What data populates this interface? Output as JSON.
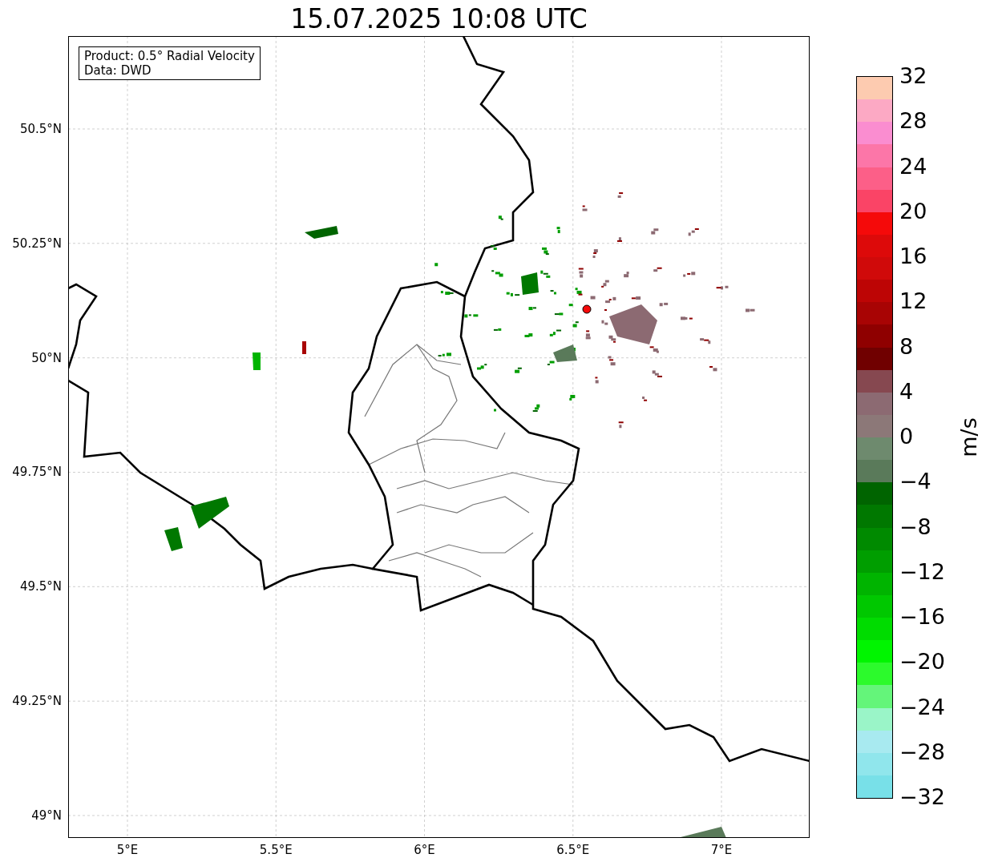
{
  "title": "15.07.2025 10:08 UTC",
  "info_box": {
    "lines": [
      "Product: 0.5° Radial Velocity",
      "Data: DWD"
    ]
  },
  "y_axis": {
    "ticks": [
      "50.5°N",
      "50.25°N",
      "50°N",
      "49.75°N",
      "49.5°N",
      "49.25°N",
      "49°N"
    ]
  },
  "x_axis": {
    "ticks": [
      "5°E",
      "5.5°E",
      "6°E",
      "6.5°E",
      "7°E"
    ]
  },
  "colorbar": {
    "label": "m/s",
    "ticks": [
      "32",
      "28",
      "24",
      "20",
      "16",
      "12",
      "8",
      "4",
      "0",
      "−4",
      "−8",
      "−12",
      "−16",
      "−20",
      "−24",
      "−28",
      "−32"
    ],
    "bins": [
      {
        "color": "#fdcbb0"
      },
      {
        "color": "#fca9c4"
      },
      {
        "color": "#fa8dd0"
      },
      {
        "color": "#fc76a8"
      },
      {
        "color": "#fc5f88"
      },
      {
        "color": "#fa4466"
      },
      {
        "color": "#f50a0a"
      },
      {
        "color": "#dd0a0a"
      },
      {
        "color": "#d00a0a"
      },
      {
        "color": "#bd0505"
      },
      {
        "color": "#a80404"
      },
      {
        "color": "#8f0000"
      },
      {
        "color": "#700000"
      },
      {
        "color": "#864850"
      },
      {
        "color": "#8c6a72"
      },
      {
        "color": "#8c7878"
      },
      {
        "color": "#6e8a6e"
      },
      {
        "color": "#5a7a5a"
      },
      {
        "color": "#006400"
      },
      {
        "color": "#007800"
      },
      {
        "color": "#008a00"
      },
      {
        "color": "#009e00"
      },
      {
        "color": "#00b400"
      },
      {
        "color": "#00c800"
      },
      {
        "color": "#00dc00"
      },
      {
        "color": "#00f500"
      },
      {
        "color": "#2cfa2c"
      },
      {
        "color": "#64f57a"
      },
      {
        "color": "#9af5c8"
      },
      {
        "color": "#a8eaf0"
      },
      {
        "color": "#90e6ec"
      },
      {
        "color": "#78e0e8"
      }
    ]
  }
}
